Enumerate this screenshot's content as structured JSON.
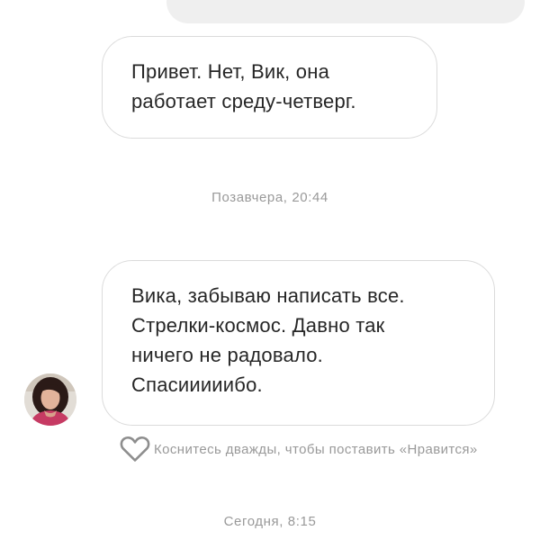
{
  "messages": [
    {
      "lines": [
        "Привет. Нет, Вик, она",
        "работает среду-четверг."
      ]
    },
    {
      "lines": [
        "Вика, забываю написать все.",
        "Стрелки-космос. Давно так",
        "ничего не радовало.",
        "Спасииииибо."
      ]
    }
  ],
  "timestamps": [
    "Позавчера, 20:44",
    "Сегодня, 8:15"
  ],
  "like_hint": {
    "icon": "heart-outline-icon",
    "text": "Коснитесь дважды, чтобы поставить «Нравится»"
  },
  "colors": {
    "bubble_border": "#dbdbdb",
    "message_text": "#262626",
    "meta_text": "#999999",
    "partial_bubble_bg": "#efefef"
  }
}
